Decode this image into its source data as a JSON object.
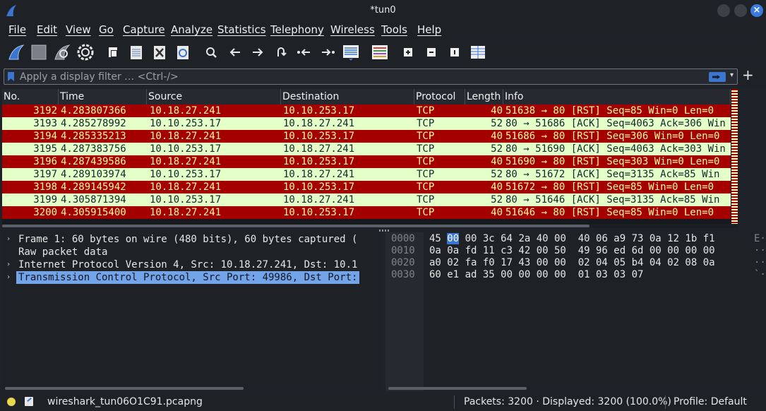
{
  "window": {
    "title": "*tun0"
  },
  "menu": [
    "File",
    "Edit",
    "View",
    "Go",
    "Capture",
    "Analyze",
    "Statistics",
    "Telephony",
    "Wireless",
    "Tools",
    "Help"
  ],
  "toolbar": {
    "icons": [
      "shark-fin-start-icon",
      "stop-capture-icon",
      "restart-capture-icon",
      "capture-options-gear-icon",
      "open-file-icon",
      "save-file-icon",
      "close-file-icon",
      "reload-file-icon",
      "find-packet-icon",
      "go-back-icon",
      "go-forward-icon",
      "go-to-packet-icon",
      "go-first-packet-icon",
      "go-last-packet-icon",
      "autoscroll-icon",
      "colorize-icon",
      "zoom-in-icon",
      "zoom-out-icon",
      "normal-size-icon",
      "resize-columns-icon"
    ]
  },
  "filter": {
    "placeholder": "Apply a display filter … <Ctrl-/>",
    "value": ""
  },
  "packet_list": {
    "columns": [
      "No.",
      "Time",
      "Source",
      "Destination",
      "Protocol",
      "Length",
      "Info"
    ],
    "rows": [
      {
        "color": "red",
        "no": "3192",
        "time": "4.283807366",
        "src": "10.18.27.241",
        "dst": "10.10.253.17",
        "proto": "TCP",
        "len": "40",
        "info": "51638 → 80 [RST] Seq=85 Win=0 Len=0"
      },
      {
        "color": "green",
        "no": "3193",
        "time": "4.285278992",
        "src": "10.10.253.17",
        "dst": "10.18.27.241",
        "proto": "TCP",
        "len": "52",
        "info": "80 → 51686 [ACK] Seq=4063 Ack=306 Win"
      },
      {
        "color": "red",
        "no": "3194",
        "time": "4.285335213",
        "src": "10.18.27.241",
        "dst": "10.10.253.17",
        "proto": "TCP",
        "len": "40",
        "info": "51686 → 80 [RST] Seq=306 Win=0 Len=0"
      },
      {
        "color": "green",
        "no": "3195",
        "time": "4.287383756",
        "src": "10.10.253.17",
        "dst": "10.18.27.241",
        "proto": "TCP",
        "len": "52",
        "info": "80 → 51690 [ACK] Seq=4063 Ack=303 Win"
      },
      {
        "color": "red",
        "no": "3196",
        "time": "4.287439586",
        "src": "10.18.27.241",
        "dst": "10.10.253.17",
        "proto": "TCP",
        "len": "40",
        "info": "51690 → 80 [RST] Seq=303 Win=0 Len=0"
      },
      {
        "color": "green",
        "no": "3197",
        "time": "4.289103974",
        "src": "10.10.253.17",
        "dst": "10.18.27.241",
        "proto": "TCP",
        "len": "52",
        "info": "80 → 51672 [ACK] Seq=3135 Ack=85 Win"
      },
      {
        "color": "red",
        "no": "3198",
        "time": "4.289145942",
        "src": "10.18.27.241",
        "dst": "10.10.253.17",
        "proto": "TCP",
        "len": "40",
        "info": "51672 → 80 [RST] Seq=85 Win=0 Len=0"
      },
      {
        "color": "green",
        "no": "3199",
        "time": "4.305871394",
        "src": "10.10.253.17",
        "dst": "10.18.27.241",
        "proto": "TCP",
        "len": "52",
        "info": "80 → 51646 [ACK] Seq=3135 Ack=85 Win"
      },
      {
        "color": "red",
        "no": "3200",
        "time": "4.305915400",
        "src": "10.18.27.241",
        "dst": "10.10.253.17",
        "proto": "TCP",
        "len": "40",
        "info": "51646 → 80 [RST] Seq=85 Win=0 Len=0"
      }
    ]
  },
  "details": [
    {
      "arrow": true,
      "selected": false,
      "text": "Frame 1: 60 bytes on wire (480 bits), 60 bytes captured ("
    },
    {
      "arrow": false,
      "selected": false,
      "text": "Raw packet data"
    },
    {
      "arrow": true,
      "selected": false,
      "text": "Internet Protocol Version 4, Src: 10.18.27.241, Dst: 10.1"
    },
    {
      "arrow": true,
      "selected": true,
      "text": "Transmission Control Protocol, Src Port: 49986, Dst Port:"
    }
  ],
  "bytes": [
    {
      "offset": "0000",
      "hl": "00",
      "pre": "45 ",
      "post": " 00 3c 64 2a 40 00  40 06 a9 73 0a 12 1b f1",
      "ascii": "E·"
    },
    {
      "offset": "0010",
      "hl": "",
      "pre": "0a 0a fd 11 c3 42 00 50  49 96 ed 6d 00 00 00 00",
      "post": "",
      "ascii": "··"
    },
    {
      "offset": "0020",
      "hl": "",
      "pre": "a0 02 fa f0 17 43 00 00  02 04 05 b4 04 02 08 0a",
      "post": "",
      "ascii": "··"
    },
    {
      "offset": "0030",
      "hl": "",
      "pre": "60 e1 ad 35 00 00 00 00  01 03 03 07",
      "post": "",
      "ascii": "`·"
    }
  ],
  "status": {
    "file": "wireshark_tun06O1C91.pcapng",
    "packets": "Packets: 3200 · Displayed: 3200 (100.0%)",
    "profile": "Profile: Default"
  },
  "colors": {
    "red_row": "#a40000",
    "green_row": "#e4ffc7",
    "accent": "#3a75d0"
  }
}
